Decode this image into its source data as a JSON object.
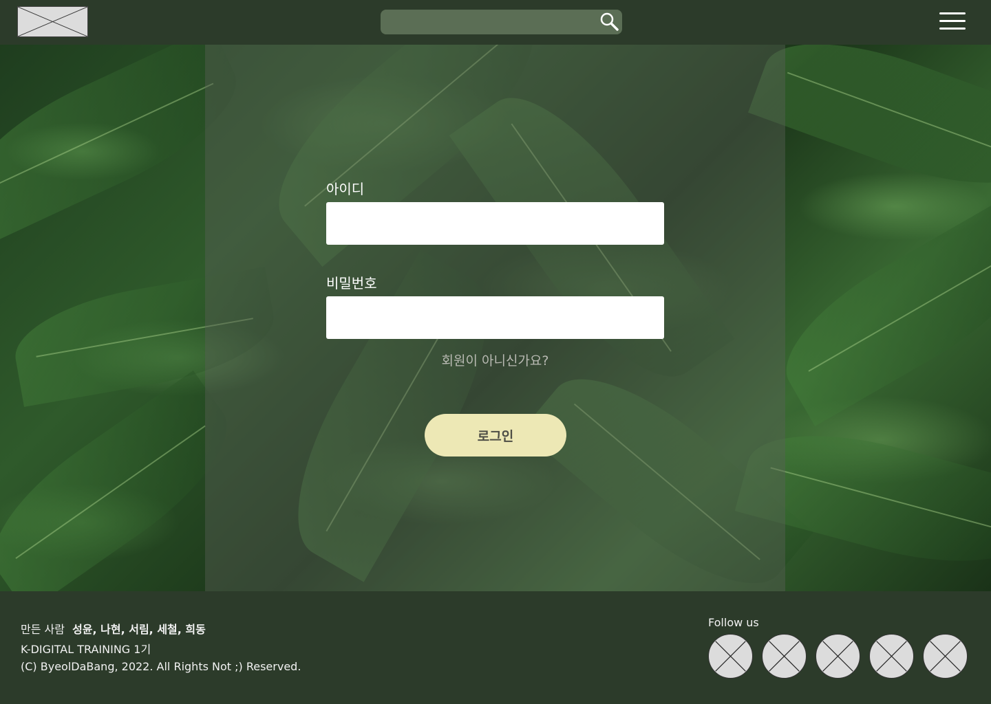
{
  "header": {
    "logo_icon": "image-placeholder-icon",
    "search": {
      "value": "",
      "placeholder": "",
      "icon": "search-icon"
    },
    "menu_icon": "hamburger-menu-icon"
  },
  "login_form": {
    "id_label": "아이디",
    "id_value": "",
    "password_label": "비밀번호",
    "password_value": "",
    "signup_link": "회원이 아니신가요?",
    "login_button": "로그인"
  },
  "footer": {
    "makers_label": "만든 사람",
    "makers_names": "성윤, 나현, 서림, 세철, 희동",
    "program": "K-DIGITAL TRAINING 1기",
    "copyright": "(C) ByeolDaBang, 2022. All Rights Not ;) Reserved.",
    "follow_label": "Follow us",
    "social_icons": [
      "social-placeholder-icon",
      "social-placeholder-icon",
      "social-placeholder-icon",
      "social-placeholder-icon",
      "social-placeholder-icon"
    ]
  },
  "colors": {
    "header_bg": "#2c3b2a",
    "footer_bg": "#2c3b2a",
    "search_bg": "#5b6e55",
    "login_button_bg": "#ede8b5",
    "login_button_text": "#4d4d45",
    "signup_link": "#b9bab3"
  }
}
